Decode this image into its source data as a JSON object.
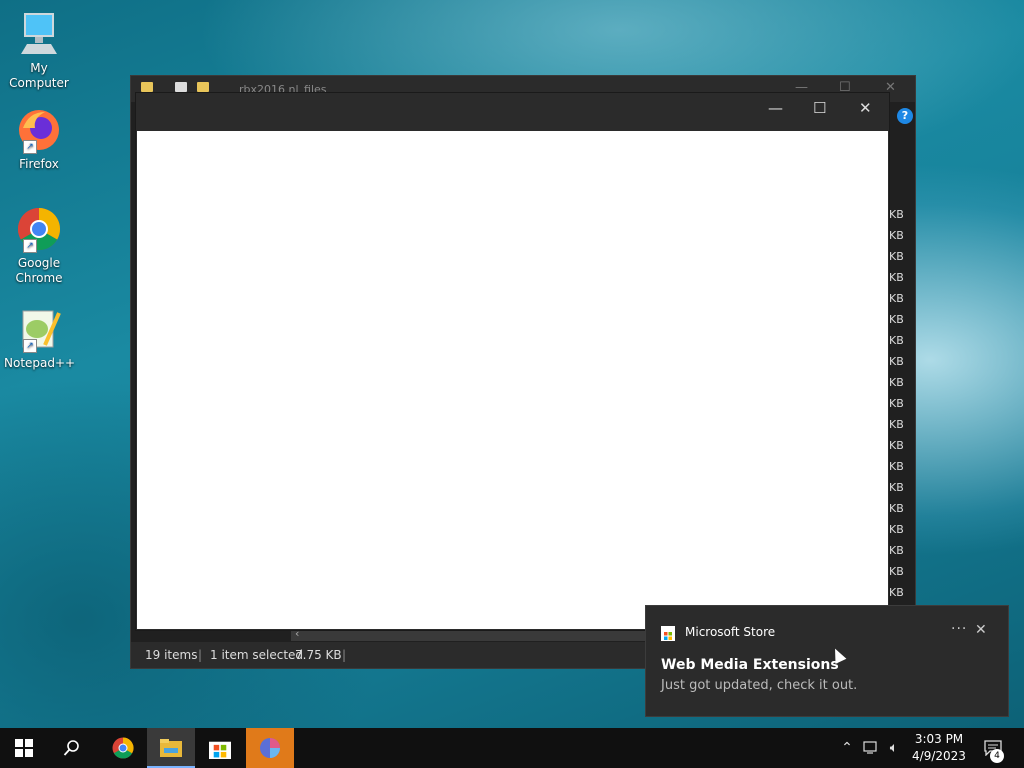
{
  "desktop": {
    "icons": [
      {
        "label": "My Computer"
      },
      {
        "label": "Firefox"
      },
      {
        "label": "Google Chrome"
      },
      {
        "label": "Notepad++"
      }
    ]
  },
  "explorer": {
    "title": "rbx2016 nl_files",
    "size_unit_fragment": "KB",
    "status": {
      "items": "19 items",
      "selected": "1 item selected",
      "size": "7.75 KB"
    }
  },
  "toast": {
    "app_name": "Microsoft Store",
    "title": "Web Media Extensions",
    "body": "Just got updated, check it out.",
    "more_label": "···"
  },
  "taskbar": {
    "time": "3:03 PM",
    "date": "4/9/2023",
    "notification_count": "4"
  },
  "colors": {
    "accent": "#7ab3ff",
    "highlight": "#e07a1a",
    "dark_window": "#2b2b2b"
  }
}
